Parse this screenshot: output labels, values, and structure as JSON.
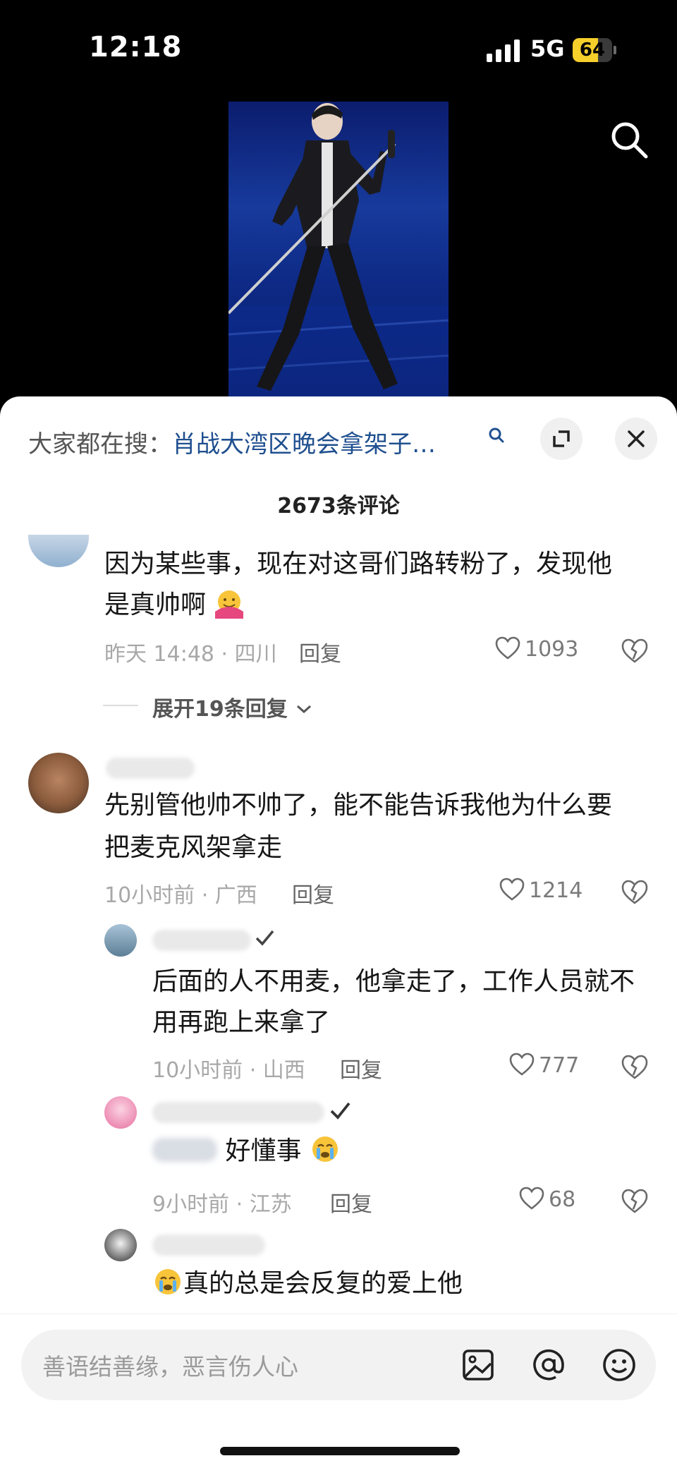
{
  "status": {
    "time": "12:18",
    "network": "5G",
    "battery": "64",
    "battery_level": 0.64
  },
  "sheet": {
    "hot_prefix": "大家都在搜：",
    "hot_query": "肖战大湾区晚会拿架子…",
    "comment_count": "2673条评论"
  },
  "comments": [
    {
      "line1": "因为某些事，现在对这哥们路转粉了，发现他",
      "line2": "是真帅啊",
      "time_loc": "昨天 14:48 · 四川",
      "reply": "回复",
      "likes": "1093",
      "expand": "展开19条回复"
    },
    {
      "line1": "先别管他帅不帅了，能不能告诉我他为什么要",
      "line2": "把麦克风架拿走",
      "time_loc": "10小时前 · 广西",
      "reply": "回复",
      "likes": "1214"
    }
  ],
  "replies": [
    {
      "line1": "后面的人不用麦，他拿走了，工作人员就不",
      "line2": "用再跑上来拿了",
      "time_loc": "10小时前 · 山西",
      "reply": "回复",
      "likes": "777"
    },
    {
      "line1": "好懂事",
      "time_loc": "9小时前 · 江苏",
      "reply": "回复",
      "likes": "68"
    },
    {
      "line1": "真的总是会反复的爱上他"
    }
  ],
  "input": {
    "placeholder": "善语结善缘，恶言伤人心"
  },
  "colors": {
    "link": "#1f4f8f",
    "battery": "#f6cf2a",
    "sheet_bg": "#ffffff"
  },
  "icons": [
    "signal-icon",
    "battery-icon",
    "search-icon",
    "expand-icon",
    "close-icon",
    "heart-icon",
    "dislike-icon",
    "image-icon",
    "at-icon",
    "emoji-icon"
  ]
}
